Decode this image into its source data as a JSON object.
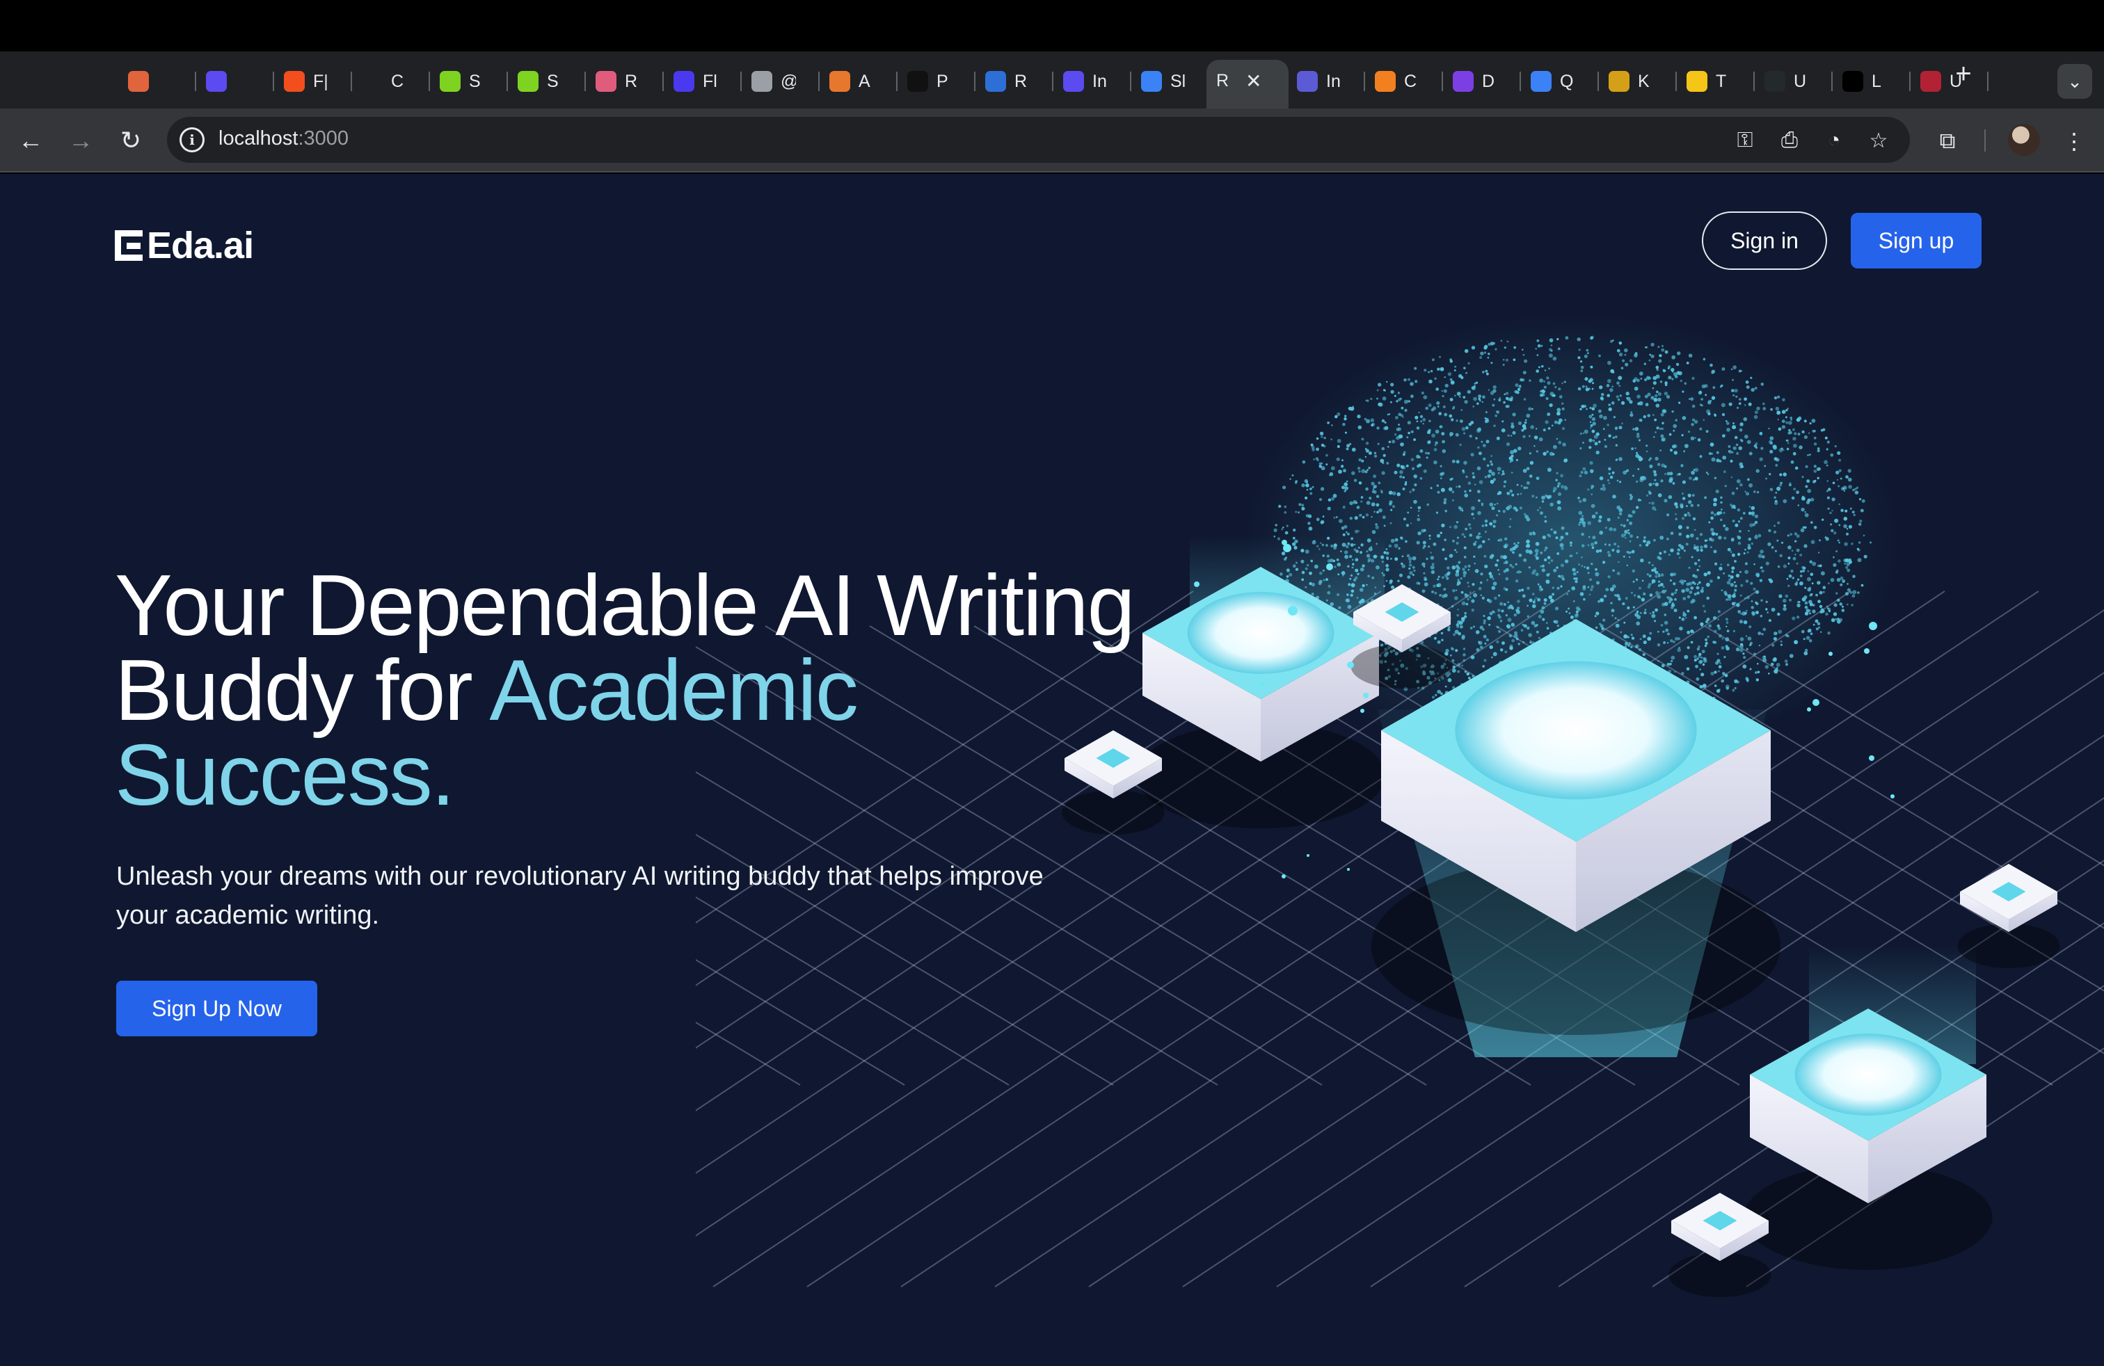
{
  "browser": {
    "tabs": [
      {
        "label": "",
        "icon": "cake-icon",
        "color": "#e0643c"
      },
      {
        "label": "",
        "icon": "c-logo-icon",
        "color": "#5b4bf0"
      },
      {
        "label": "F|",
        "icon": "figma-icon",
        "color": "#f24e1e"
      },
      {
        "label": "C",
        "icon": "play-icon",
        "color": "#202124"
      },
      {
        "label": "S",
        "icon": "globe-green-icon",
        "color": "#7ed321"
      },
      {
        "label": "S",
        "icon": "globe-green-icon",
        "color": "#7ed321"
      },
      {
        "label": "R",
        "icon": "react-icon",
        "color": "#e05c7c"
      },
      {
        "label": "Fl",
        "icon": "flutterflow-icon",
        "color": "#4b39ef"
      },
      {
        "label": "@",
        "icon": "house-icon",
        "color": "#9aa0a6"
      },
      {
        "label": "A",
        "icon": "box-icon",
        "color": "#e8772e"
      },
      {
        "label": "P",
        "icon": "openai-icon",
        "color": "#111111"
      },
      {
        "label": "R",
        "icon": "eye-icon",
        "color": "#2d6fd6"
      },
      {
        "label": "In",
        "icon": "c-logo-icon",
        "color": "#5b4bf0"
      },
      {
        "label": "Sl",
        "icon": "diamond-icon",
        "color": "#3b82f6"
      },
      {
        "label": "R",
        "icon": "none",
        "color": "#3c4043",
        "active": true
      },
      {
        "label": "In",
        "icon": "s-logo-icon",
        "color": "#5b5bd6"
      },
      {
        "label": "C",
        "icon": "cloud-icon",
        "color": "#f38020"
      },
      {
        "label": "D",
        "icon": "h-logo-icon",
        "color": "#7b3fe4"
      },
      {
        "label": "Q",
        "icon": "q-logo-icon",
        "color": "#3b82f6"
      },
      {
        "label": "K",
        "icon": "k-logo-icon",
        "color": "#d4a017"
      },
      {
        "label": "T",
        "icon": "c-yellow-icon",
        "color": "#f5c518"
      },
      {
        "label": "U",
        "icon": "github-icon",
        "color": "#24292e"
      },
      {
        "label": "L",
        "icon": "triangle-icon",
        "color": "#000000"
      },
      {
        "label": "U",
        "icon": "flag-icon",
        "color": "#b22234"
      }
    ],
    "new_tab_glyph": "+",
    "tab_search_glyph": "⌄",
    "url_host": "localhost",
    "url_port": ":3000"
  },
  "page": {
    "logo_text": "Eda.ai",
    "nav": {
      "signin_label": "Sign in",
      "signup_label": "Sign up"
    },
    "hero": {
      "title_line1": "Your Dependable AI Writing",
      "title_line2_plain": "Buddy for ",
      "title_line2_accent": "Academic",
      "title_line3_accent": "Success.",
      "subtitle": "Unleash your dreams with our revolutionary AI writing buddy that helps improve your academic writing.",
      "cta_label": "Sign Up Now"
    },
    "colors": {
      "background": "#0f1830",
      "accent": "#7fd4ea",
      "primary": "#2563eb"
    }
  }
}
